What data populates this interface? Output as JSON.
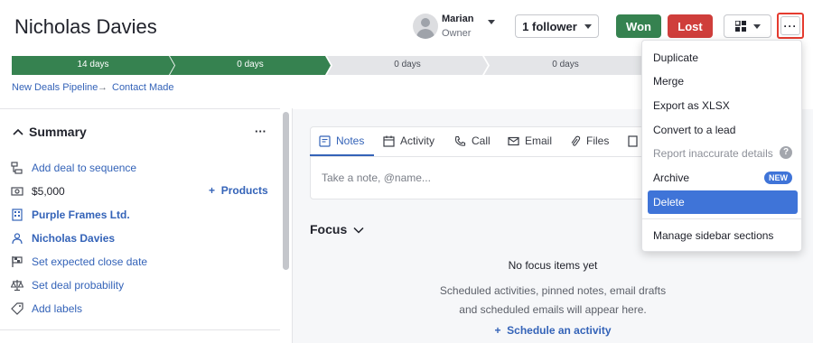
{
  "header": {
    "title": "Nicholas Davies",
    "owner_name": "Marian",
    "owner_role": "Owner",
    "follower_label": "1 follower",
    "won_label": "Won",
    "lost_label": "Lost",
    "more_label": "···"
  },
  "pipeline": {
    "stages": [
      {
        "label": "14 days",
        "state": "done"
      },
      {
        "label": "0 days",
        "state": "done"
      },
      {
        "label": "0 days",
        "state": "pending"
      },
      {
        "label": "0 days",
        "state": "pending"
      }
    ],
    "breadcrumb": [
      "New Deals Pipeline",
      "Contact Made"
    ],
    "breadcrumb_separator": "→"
  },
  "summary": {
    "title": "Summary",
    "more_label": "···",
    "rows": [
      {
        "icon": "sequence-icon",
        "text": "Add deal to sequence"
      },
      {
        "icon": "money-icon",
        "text": "$5,000"
      },
      {
        "icon": "building-icon",
        "text": "Purple Frames Ltd."
      },
      {
        "icon": "person-icon",
        "text": "Nicholas Davies"
      },
      {
        "icon": "flag-icon",
        "text": "Set expected close date"
      },
      {
        "icon": "scale-icon",
        "text": "Set deal probability"
      },
      {
        "icon": "tag-icon",
        "text": "Add labels"
      }
    ],
    "products_label": "Products"
  },
  "composer": {
    "tabs": [
      "Notes",
      "Activity",
      "Call",
      "Email",
      "Files"
    ],
    "active_tab": "Notes",
    "placeholder": "Take a note, @name..."
  },
  "focus": {
    "title": "Focus",
    "empty_title": "No focus items yet",
    "empty_line1": "Scheduled activities, pinned notes, email drafts",
    "empty_line2": "and scheduled emails will appear here.",
    "schedule_label": "Schedule an activity"
  },
  "menu": {
    "items": [
      {
        "label": "Duplicate"
      },
      {
        "label": "Merge"
      },
      {
        "label": "Export as XLSX"
      },
      {
        "label": "Convert to a lead"
      },
      {
        "label": "Report inaccurate details"
      },
      {
        "label": "Archive",
        "badge": "NEW"
      },
      {
        "label": "Delete"
      },
      {
        "label": "Manage sidebar sections"
      }
    ]
  },
  "colors": {
    "accent": "#3463b8",
    "won": "#368250",
    "lost": "#cf3e3b",
    "stage_done": "#368250",
    "stage_pending": "#e4e5e8"
  }
}
